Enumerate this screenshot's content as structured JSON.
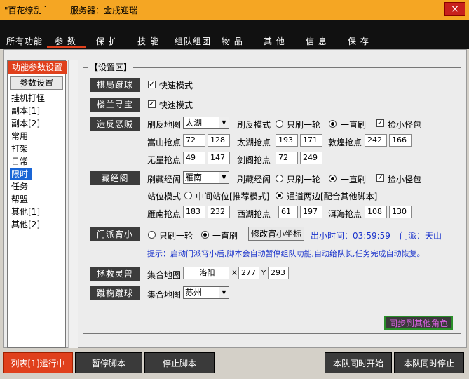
{
  "window": {
    "app_title": "\"百花缭乱",
    "title_arrow": "ˇ",
    "server_label": "服务器：金戌迎瑞",
    "close_glyph": "×"
  },
  "tabs": [
    "所有功能",
    "参 数",
    "保 护",
    "技 能",
    "组队组团",
    "物 品",
    "其 他",
    "信 息",
    "保 存"
  ],
  "sidebar": {
    "header": "功能参数设置",
    "button": "参数设置",
    "items": [
      "挂机打怪",
      "副本[1]",
      "副本[2]",
      "常用",
      "打架",
      "日常",
      "限时",
      "任务",
      "帮盟",
      "其他[1]",
      "其他[2]"
    ],
    "selected": "限时"
  },
  "settings": {
    "legend": "【设置区】",
    "qiju": {
      "title": "棋局蹴球",
      "fast_label": "快速模式",
      "fast_checked": true
    },
    "louxi": {
      "title": "楼兰寻宝",
      "fast_label": "快速模式",
      "fast_checked": true
    },
    "zaofan": {
      "title": "造反恶贼",
      "map_label": "刷反地图",
      "map_value": "太湖",
      "mode_label": "刷反模式",
      "once_label": "只刷一轮",
      "always_label": "一直刷",
      "pick_label": "捡小怪包",
      "pick_checked": true,
      "songshan_label": "嵩山抢点",
      "songshan_x": "72",
      "songshan_y": "128",
      "taihu_label": "太湖抢点",
      "taihu_x": "193",
      "taihu_y": "171",
      "dunhuang_label": "敦煌抢点",
      "dunhuang_x": "242",
      "dunhuang_y": "166",
      "wuliang_label": "无量抢点",
      "wuliang_x": "49",
      "wuliang_y": "147",
      "jiange_label": "剑阁抢点",
      "jiange_x": "72",
      "jiange_y": "249"
    },
    "cangjing": {
      "title": "藏经阁",
      "map_label": "刷藏经阁",
      "map_value": "雁南",
      "mode_label": "刷藏经阁",
      "once_label": "只刷一轮",
      "always_label": "一直刷",
      "pick_label": "捡小怪包",
      "pick_checked": true,
      "station_label": "站位模式",
      "mid_label": "中间站位[推荐模式]",
      "side_label": "通道两边[配合其他脚本]",
      "yannan_label": "雁南抢点",
      "yannan_x": "183",
      "yannan_y": "232",
      "xihu_label": "西湖抢点",
      "xihu_x": "61",
      "xihu_y": "197",
      "erhai_label": "洱海抢点",
      "erhai_x": "108",
      "erhai_y": "130"
    },
    "menpai": {
      "title": "门派宵小",
      "once_label": "只刷一轮",
      "always_label": "一直刷",
      "edit_button": "修改宵小坐标",
      "time_label": "出小时间：03:59:59",
      "menpai_label": "门派：天山",
      "hint": "提示：启动门派宵小后,脚本会自动暂停组队功能,自动给队长,任务完成自动恢复。"
    },
    "lingshou": {
      "title": "拯救灵兽",
      "map_label": "集合地图",
      "map_value": "洛阳",
      "x_label": "X",
      "x_value": "277",
      "y_label": "Y",
      "y_value": "293"
    },
    "cuju": {
      "title": "蹴鞠蹴球",
      "map_label": "集合地图",
      "map_value": "苏州"
    },
    "sync_button": "同步到其他角色"
  },
  "bottom": {
    "status": "列表[1]运行中",
    "pause": "暂停脚本",
    "stop": "停止脚本",
    "team_start": "本队同时开始",
    "team_stop": "本队同时停止"
  },
  "colors": {
    "accent": "#e0401c",
    "titlebar": "#f5a623",
    "hint_blue": "#1a33cc",
    "sync_purple": "#9a2aa0"
  }
}
